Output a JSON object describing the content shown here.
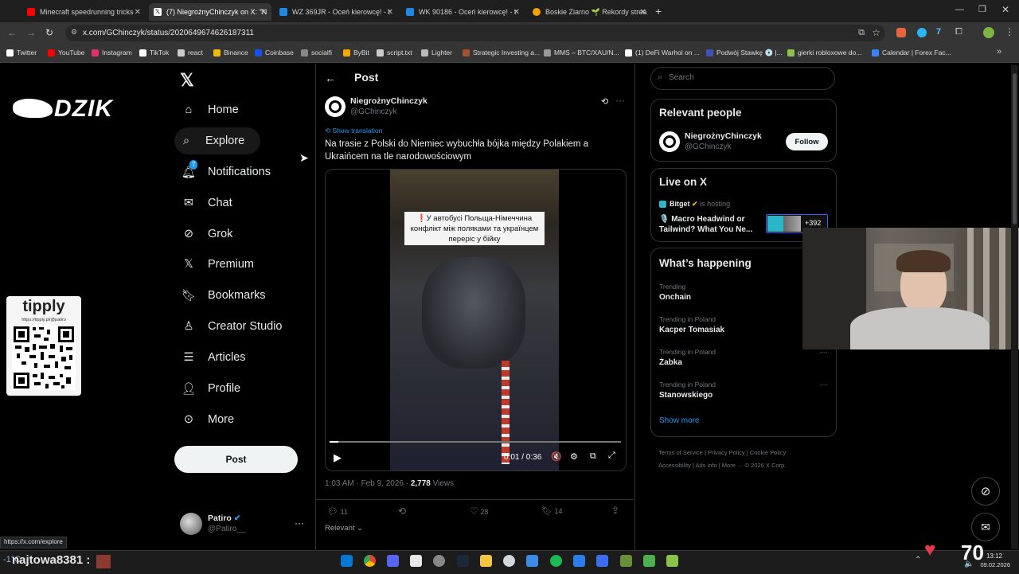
{
  "browser": {
    "tabs": [
      {
        "label": "Minecraft speedrunning tricks",
        "color": "#ff0000"
      },
      {
        "label": "(7) NiegrożnyChinczyk on X: \"N",
        "color": "#ffffff"
      },
      {
        "label": "WZ 369JR - Oceń kierowcę! - t",
        "color": "#1e88e5"
      },
      {
        "label": "WK 90186 - Oceń kierowcę! - t",
        "color": "#1e88e5"
      },
      {
        "label": "Boskie Ziarno 🌱 Rekordy strea",
        "color": "#f4a300"
      }
    ],
    "url": "x.com/GChinczyk/status/2020649674626187311",
    "bookmarks": [
      "Twitter",
      "YouTube",
      "Instagram",
      "TikTok",
      "react",
      "Binance",
      "Coinbase",
      "socialfi",
      "ByBit",
      "script.txt",
      "Lighter",
      "Strategic Investing a...",
      "MMS – BTC/XAU/N...",
      "(1) DeFi Warhol on ...",
      "Podwój Stawkę 💿 |...",
      "gierki robloxowe do...",
      "Calendar | Forex Fac..."
    ],
    "status_url": "https://x.com/explore"
  },
  "overlay": {
    "brand": "DZIK",
    "tipply_title": "tipply",
    "tipply_url": "https://tipply.pl/@patiro"
  },
  "nav": {
    "items": [
      {
        "label": "Home",
        "icon": "home-icon"
      },
      {
        "label": "Explore",
        "icon": "search-icon"
      },
      {
        "label": "Notifications",
        "icon": "bell-icon",
        "badge": "7"
      },
      {
        "label": "Chat",
        "icon": "mail-icon"
      },
      {
        "label": "Grok",
        "icon": "grok-icon"
      },
      {
        "label": "Premium",
        "icon": "x-icon"
      },
      {
        "label": "Bookmarks",
        "icon": "bookmark-icon"
      },
      {
        "label": "Creator Studio",
        "icon": "creator-icon"
      },
      {
        "label": "Articles",
        "icon": "article-icon"
      },
      {
        "label": "Profile",
        "icon": "person-icon"
      },
      {
        "label": "More",
        "icon": "more-icon"
      }
    ],
    "post_label": "Post",
    "account": {
      "name": "Patiro",
      "handle": "@Patiro__"
    }
  },
  "post": {
    "header": "Post",
    "author": "NiegrożnyChinczyk",
    "handle": "@GChinczyk",
    "show_translation": "Show translation",
    "text": "Na trasie z Polski do Niemiec wybuchła bójka między Polakiem a Ukraińcem na tle narodowościowym",
    "video_caption": "У автобусі Польща-Німеччина конфлікт між поляками та українцем перерiс у бійку",
    "video_time": "0:01 / 0:36",
    "video_progress": 0.03,
    "timestamp": "1:03 AM · Feb 9, 2026 · ",
    "views_count": "2,778",
    "views_label": " Views",
    "stats": {
      "replies": "11",
      "reposts": "",
      "likes": "28",
      "bookmarks": "14"
    },
    "sort_label": "Relevant"
  },
  "right": {
    "search_placeholder": "Search",
    "relevant_title": "Relevant people",
    "relevant_name": "NiegrożnyChinczyk",
    "relevant_handle": "@GChinczyk",
    "follow_label": "Follow",
    "live_title": "Live on X",
    "live_host": "Bitget",
    "live_hosting": "is hosting",
    "live_topic": "🎙️ Macro Headwind or Tailwind? What You Ne...",
    "live_count": "+392",
    "happening_title": "What’s happening",
    "trends": [
      {
        "sub": "Trending",
        "name": "Onchain"
      },
      {
        "sub": "Trending in Poland",
        "name": "Kacper Tomasiak"
      },
      {
        "sub": "Trending in Poland",
        "name": "Żabka"
      },
      {
        "sub": "Trending in Poland",
        "name": "Stanowskiego"
      }
    ],
    "show_more": "Show more",
    "footer_links": [
      "Terms of Service",
      "Privacy Policy",
      "Cookie Policy",
      "Accessibility",
      "Ads info",
      "More ···",
      "© 2026 X Corp."
    ]
  },
  "taskbar": {
    "username": "najtowa8381",
    "temperature": "-1°C",
    "heart_count": "70",
    "clock_time": "13:12",
    "clock_date": "09.02.2026"
  },
  "colors": {
    "accent": "#1d9bf0",
    "background": "#000000",
    "border": "#2f3336"
  }
}
